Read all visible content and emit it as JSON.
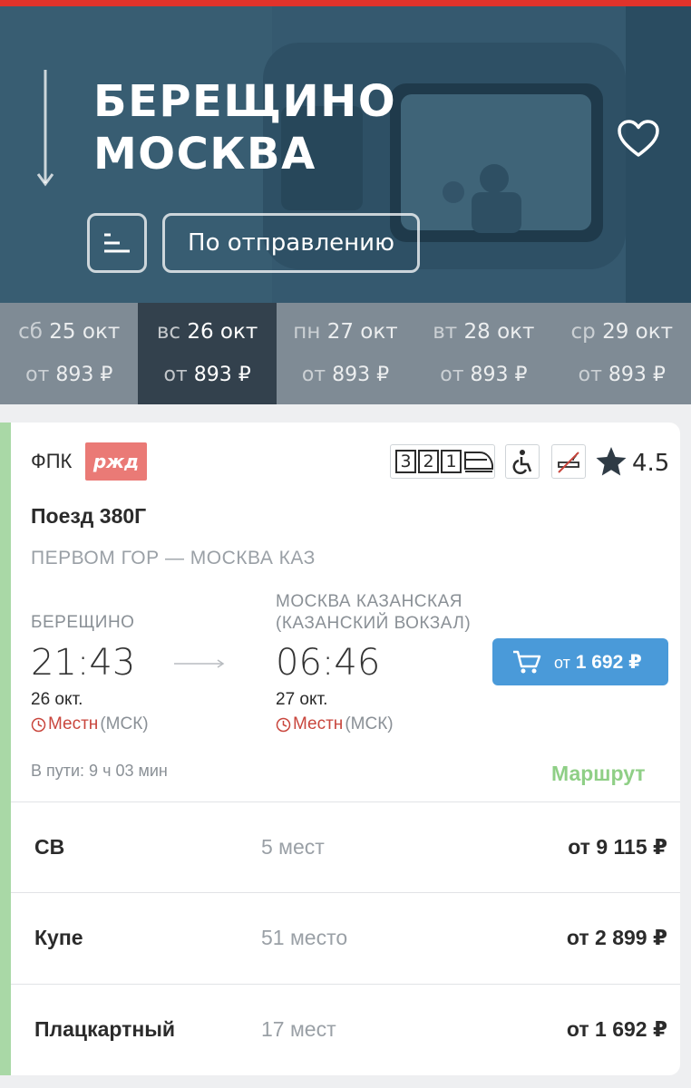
{
  "header": {
    "from": "БЕРЕЩИНО",
    "to": "МОСКВА",
    "sort_label": "По отправлению"
  },
  "dates": [
    {
      "dow": "сб",
      "date": "25 окт",
      "price_prefix": "от",
      "price": "893 ₽"
    },
    {
      "dow": "вс",
      "date": "26 окт",
      "price_prefix": "от",
      "price": "893 ₽"
    },
    {
      "dow": "пн",
      "date": "27 окт",
      "price_prefix": "от",
      "price": "893 ₽"
    },
    {
      "dow": "вт",
      "date": "28 окт",
      "price_prefix": "от",
      "price": "893 ₽"
    },
    {
      "dow": "ср",
      "date": "29 окт",
      "price_prefix": "от",
      "price": "893 ₽"
    }
  ],
  "train": {
    "carrier": "ФПК",
    "logo_text": "ржд",
    "classes": [
      "3",
      "2",
      "1"
    ],
    "rating": "4.5",
    "name": "Поезд 380Г",
    "route": "ПЕРВОМ ГОР — МОСКВА КАЗ",
    "departure": {
      "station": "БЕРЕЩИНО",
      "time": "21:43",
      "date": "26 окт.",
      "tz_local": "Местн",
      "tz_msk": "(МСК)"
    },
    "arrival": {
      "station": "МОСКВА КАЗАНСКАЯ (КАЗАНСКИЙ ВОКЗАЛ)",
      "time": "06:46",
      "date": "27 окт.",
      "tz_local": "Местн",
      "tz_msk": "(МСК)"
    },
    "buy_prefix": "от",
    "buy_price": "1 692 ₽",
    "duration": "В пути: 9 ч 03 мин",
    "route_link": "Маршрут"
  },
  "car_classes": [
    {
      "name": "СВ",
      "seats": "5 мест",
      "price": "от 9 115 ₽"
    },
    {
      "name": "Купе",
      "seats": "51 место",
      "price": "от 2 899 ₽"
    },
    {
      "name": "Плацкартный",
      "seats": "17 мест",
      "price": "от 1 692 ₽"
    }
  ],
  "colors": {
    "top_bar": "#e1332b",
    "accent_green": "#a9d8a6",
    "buy_button": "#4a9ad9",
    "local_time": "#c9463d",
    "active_date": "#33414d"
  }
}
